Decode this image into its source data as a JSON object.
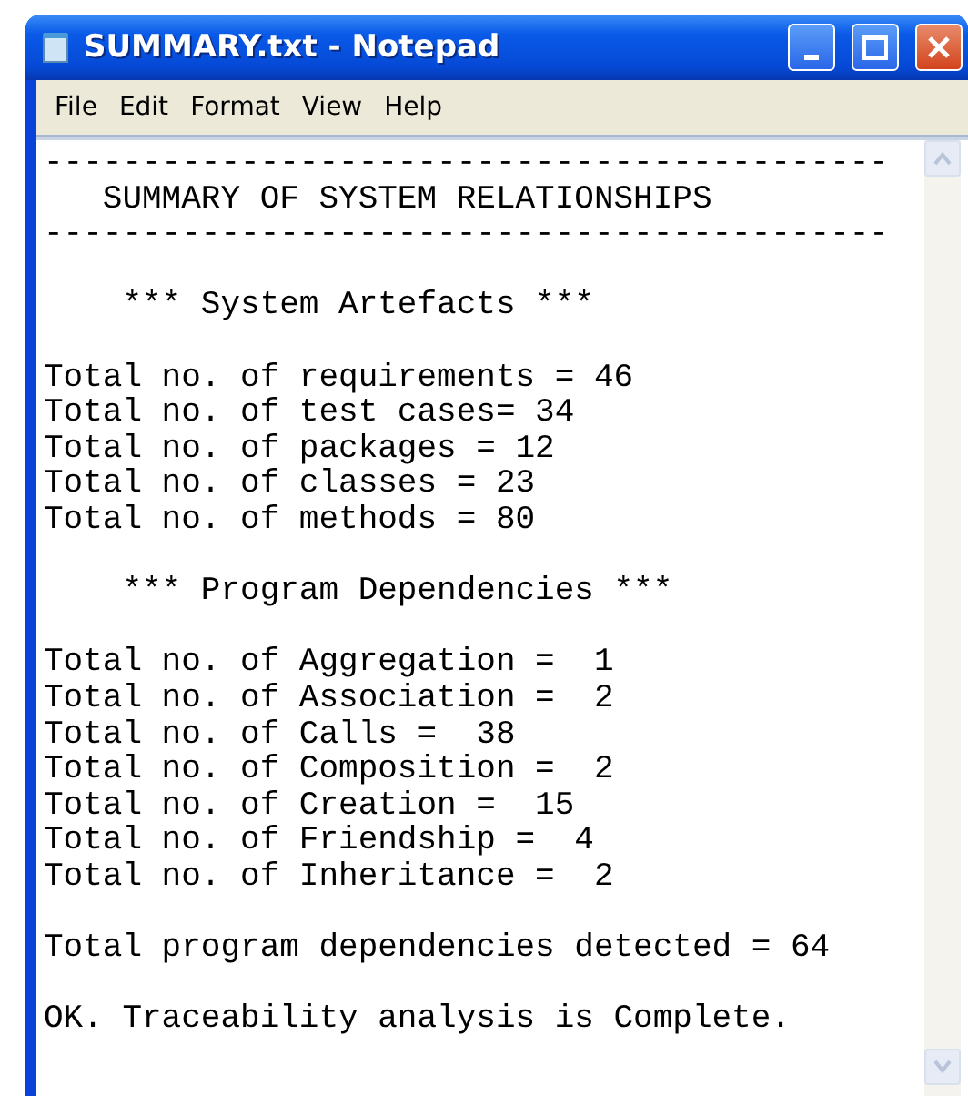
{
  "window": {
    "title": "SUMMARY.txt - Notepad"
  },
  "menu": [
    "File",
    "Edit",
    "Format",
    "View",
    "Help"
  ],
  "document": {
    "lines": [
      {
        "text": "-------------------------------------------",
        "gap_before": false
      },
      {
        "text": "   SUMMARY OF SYSTEM RELATIONSHIPS",
        "gap_before": false
      },
      {
        "text": "-------------------------------------------",
        "gap_before": false
      },
      {
        "text": "    *** System Artefacts ***",
        "gap_before": true
      },
      {
        "text": "Total no. of requirements = 46",
        "gap_before": true
      },
      {
        "text": "Total no. of test cases= 34",
        "gap_before": false
      },
      {
        "text": "Total no. of packages = 12",
        "gap_before": false
      },
      {
        "text": "Total no. of classes = 23",
        "gap_before": false
      },
      {
        "text": "Total no. of methods = 80",
        "gap_before": false
      },
      {
        "text": "    *** Program Dependencies ***",
        "gap_before": true
      },
      {
        "text": "Total no. of Aggregation =  1",
        "gap_before": true
      },
      {
        "text": "Total no. of Association =  2",
        "gap_before": false
      },
      {
        "text": "Total no. of Calls =  38",
        "gap_before": false
      },
      {
        "text": "Total no. of Composition =  2",
        "gap_before": false
      },
      {
        "text": "Total no. of Creation =  15",
        "gap_before": false
      },
      {
        "text": "Total no. of Friendship =  4",
        "gap_before": false
      },
      {
        "text": "Total no. of Inheritance =  2",
        "gap_before": false
      },
      {
        "text": "Total program dependencies detected = 64",
        "gap_before": true
      },
      {
        "text": "OK. Traceability analysis is Complete.",
        "gap_before": true
      }
    ]
  }
}
